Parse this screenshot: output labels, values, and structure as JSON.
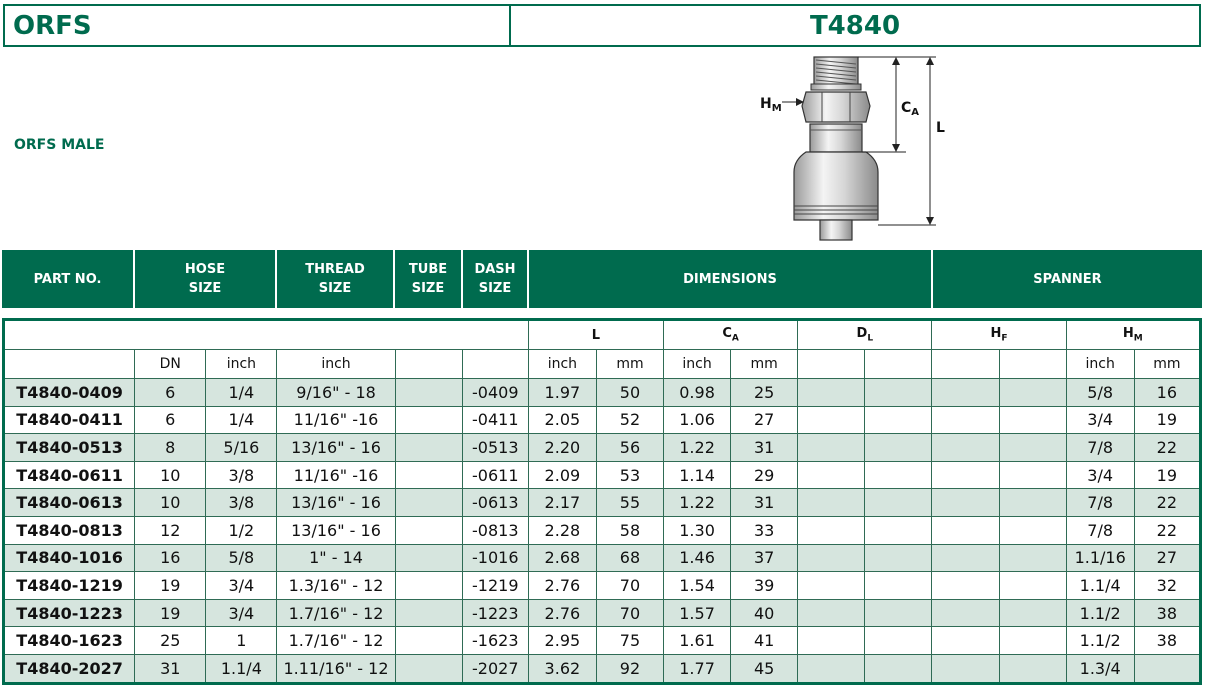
{
  "header": {
    "left": "ORFS",
    "right": "T4840"
  },
  "subtitle": "ORFS MALE",
  "drawing": {
    "label_hm": "H",
    "label_hm_sub": "M",
    "label_ca": "C",
    "label_ca_sub": "A",
    "label_l": "L"
  },
  "group_header": {
    "part_no": "PART NO.",
    "hose_size_1": "HOSE",
    "hose_size_2": "SIZE",
    "thread_size_1": "THREAD",
    "thread_size_2": "SIZE",
    "tube_size_1": "TUBE",
    "tube_size_2": "SIZE",
    "dash_size_1": "DASH",
    "dash_size_2": "SIZE",
    "dimensions": "DIMENSIONS",
    "spanner": "SPANNER"
  },
  "dim_header": {
    "l": "L",
    "ca": "C",
    "ca_sub": "A",
    "dl": "D",
    "dl_sub": "L",
    "hf": "H",
    "hf_sub": "F",
    "hm": "H",
    "hm_sub": "M"
  },
  "unit_header": {
    "dn": "DN",
    "hose_inch": "inch",
    "thread_inch": "inch",
    "l_inch": "inch",
    "l_mm": "mm",
    "ca_inch": "inch",
    "ca_mm": "mm",
    "hm_inch": "inch",
    "hm_mm": "mm"
  },
  "rows": [
    {
      "part": "T4840-0409",
      "dn": "6",
      "hose": "1/4",
      "thread": "9/16\" - 18",
      "tube": "",
      "dash": "-0409",
      "l_in": "1.97",
      "l_mm": "50",
      "ca_in": "0.98",
      "ca_mm": "25",
      "hm_in": "5/8",
      "hm_mm": "16"
    },
    {
      "part": "T4840-0411",
      "dn": "6",
      "hose": "1/4",
      "thread": "11/16\" -16",
      "tube": "",
      "dash": "-0411",
      "l_in": "2.05",
      "l_mm": "52",
      "ca_in": "1.06",
      "ca_mm": "27",
      "hm_in": "3/4",
      "hm_mm": "19"
    },
    {
      "part": "T4840-0513",
      "dn": "8",
      "hose": "5/16",
      "thread": "13/16\" - 16",
      "tube": "",
      "dash": "-0513",
      "l_in": "2.20",
      "l_mm": "56",
      "ca_in": "1.22",
      "ca_mm": "31",
      "hm_in": "7/8",
      "hm_mm": "22"
    },
    {
      "part": "T4840-0611",
      "dn": "10",
      "hose": "3/8",
      "thread": "11/16\" -16",
      "tube": "",
      "dash": "-0611",
      "l_in": "2.09",
      "l_mm": "53",
      "ca_in": "1.14",
      "ca_mm": "29",
      "hm_in": "3/4",
      "hm_mm": "19"
    },
    {
      "part": "T4840-0613",
      "dn": "10",
      "hose": "3/8",
      "thread": "13/16\" - 16",
      "tube": "",
      "dash": "-0613",
      "l_in": "2.17",
      "l_mm": "55",
      "ca_in": "1.22",
      "ca_mm": "31",
      "hm_in": "7/8",
      "hm_mm": "22"
    },
    {
      "part": "T4840-0813",
      "dn": "12",
      "hose": "1/2",
      "thread": "13/16\" - 16",
      "tube": "",
      "dash": "-0813",
      "l_in": "2.28",
      "l_mm": "58",
      "ca_in": "1.30",
      "ca_mm": "33",
      "hm_in": "7/8",
      "hm_mm": "22"
    },
    {
      "part": "T4840-1016",
      "dn": "16",
      "hose": "5/8",
      "thread": "1\" - 14",
      "tube": "",
      "dash": "-1016",
      "l_in": "2.68",
      "l_mm": "68",
      "ca_in": "1.46",
      "ca_mm": "37",
      "hm_in": "1.1/16",
      "hm_mm": "27"
    },
    {
      "part": "T4840-1219",
      "dn": "19",
      "hose": "3/4",
      "thread": "1.3/16\" - 12",
      "tube": "",
      "dash": "-1219",
      "l_in": "2.76",
      "l_mm": "70",
      "ca_in": "1.54",
      "ca_mm": "39",
      "hm_in": "1.1/4",
      "hm_mm": "32"
    },
    {
      "part": "T4840-1223",
      "dn": "19",
      "hose": "3/4",
      "thread": "1.7/16\" - 12",
      "tube": "",
      "dash": "-1223",
      "l_in": "2.76",
      "l_mm": "70",
      "ca_in": "1.57",
      "ca_mm": "40",
      "hm_in": "1.1/2",
      "hm_mm": "38"
    },
    {
      "part": "T4840-1623",
      "dn": "25",
      "hose": "1",
      "thread": "1.7/16\" - 12",
      "tube": "",
      "dash": "-1623",
      "l_in": "2.95",
      "l_mm": "75",
      "ca_in": "1.61",
      "ca_mm": "41",
      "hm_in": "1.1/2",
      "hm_mm": "38"
    },
    {
      "part": "T4840-2027",
      "dn": "31",
      "hose": "1.1/4",
      "thread": "1.11/16\" - 12",
      "tube": "",
      "dash": "-2027",
      "l_in": "3.62",
      "l_mm": "92",
      "ca_in": "1.77",
      "ca_mm": "45",
      "hm_in": "1.3/4",
      "hm_mm": ""
    }
  ]
}
